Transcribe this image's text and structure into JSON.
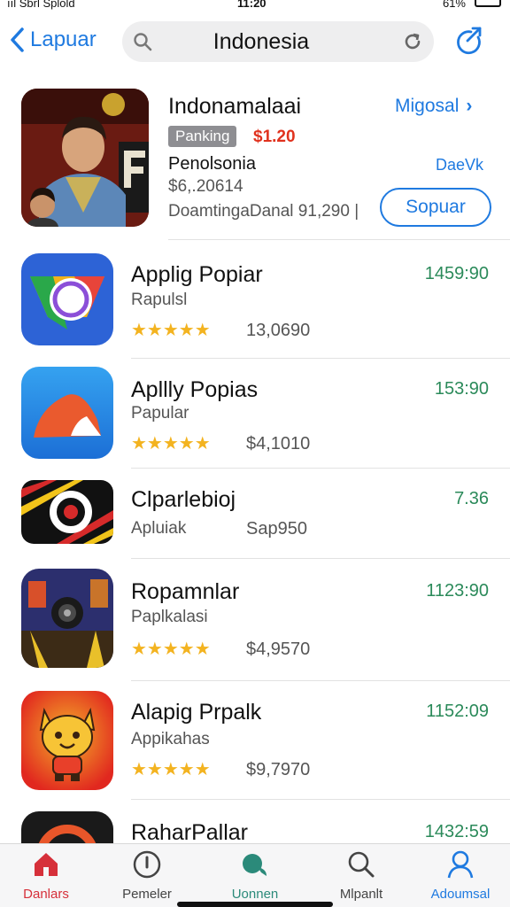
{
  "status": {
    "carrier": "ııl Sbrl Splold",
    "time": "11:20",
    "battery": "61%"
  },
  "header": {
    "back_label": "Lapuar",
    "search_query": "Indonesia"
  },
  "featured": {
    "title": "Indonamalaai",
    "link_label": "Migosal",
    "badge": "Panking",
    "price": "$1.20",
    "subtitle": "Penolsonia",
    "developer": "DaeVk",
    "meta1": "$6,.20614",
    "meta2": "DoamtingaDanal 91,290 |",
    "button_label": "Sopuar"
  },
  "apps": [
    {
      "name": "Applig Popiar",
      "category": "Rapulsl",
      "rating": 4.5,
      "stars_text": "★★★★★",
      "count": "13,0690",
      "value": "1459:90",
      "icon": "chrome-like-icon"
    },
    {
      "name": "Apllly Popias",
      "category": "Papular",
      "rating": 4.5,
      "stars_text": "★★★★★",
      "count": "$4,1010",
      "value": "153:90",
      "icon": "flame-app-icon"
    },
    {
      "name": "Clparlebioj",
      "category": "Apluiak",
      "rating": null,
      "stars_text": "",
      "count": "Sap950",
      "value": "7.36",
      "icon": "striped-app-icon"
    },
    {
      "name": "Ropamnlar",
      "category": "Paplkalasi",
      "rating": 4.5,
      "stars_text": "★★★★★",
      "count": "$4,9570",
      "value": "1123:90",
      "icon": "camera-game-icon"
    },
    {
      "name": "Alapig Prpalk",
      "category": "Appikahas",
      "rating": 4.5,
      "stars_text": "★★★★★",
      "count": "$9,7970",
      "value": "1152:09",
      "icon": "cat-mascot-icon"
    },
    {
      "name": "RaharPallar",
      "category": "",
      "rating": null,
      "stars_text": "",
      "count": "",
      "value": "1432:59",
      "icon": "partial-app-icon"
    }
  ],
  "tabs": [
    {
      "label": "Danlars",
      "icon": "home-icon",
      "color": "#d6303a"
    },
    {
      "label": "Pemeler",
      "icon": "info-circle-icon",
      "color": "#444444"
    },
    {
      "label": "Uonnen",
      "icon": "chat-icon",
      "color": "#2b8a7a"
    },
    {
      "label": "Mlpanlt",
      "icon": "search-icon",
      "color": "#444444"
    },
    {
      "label": "Adoumsal",
      "icon": "profile-icon",
      "color": "#1f7ae0"
    }
  ],
  "colors": {
    "accent": "#1f7ae0",
    "price_red": "#e0321e",
    "value_green": "#2b8a5a",
    "star": "#f3b320"
  }
}
